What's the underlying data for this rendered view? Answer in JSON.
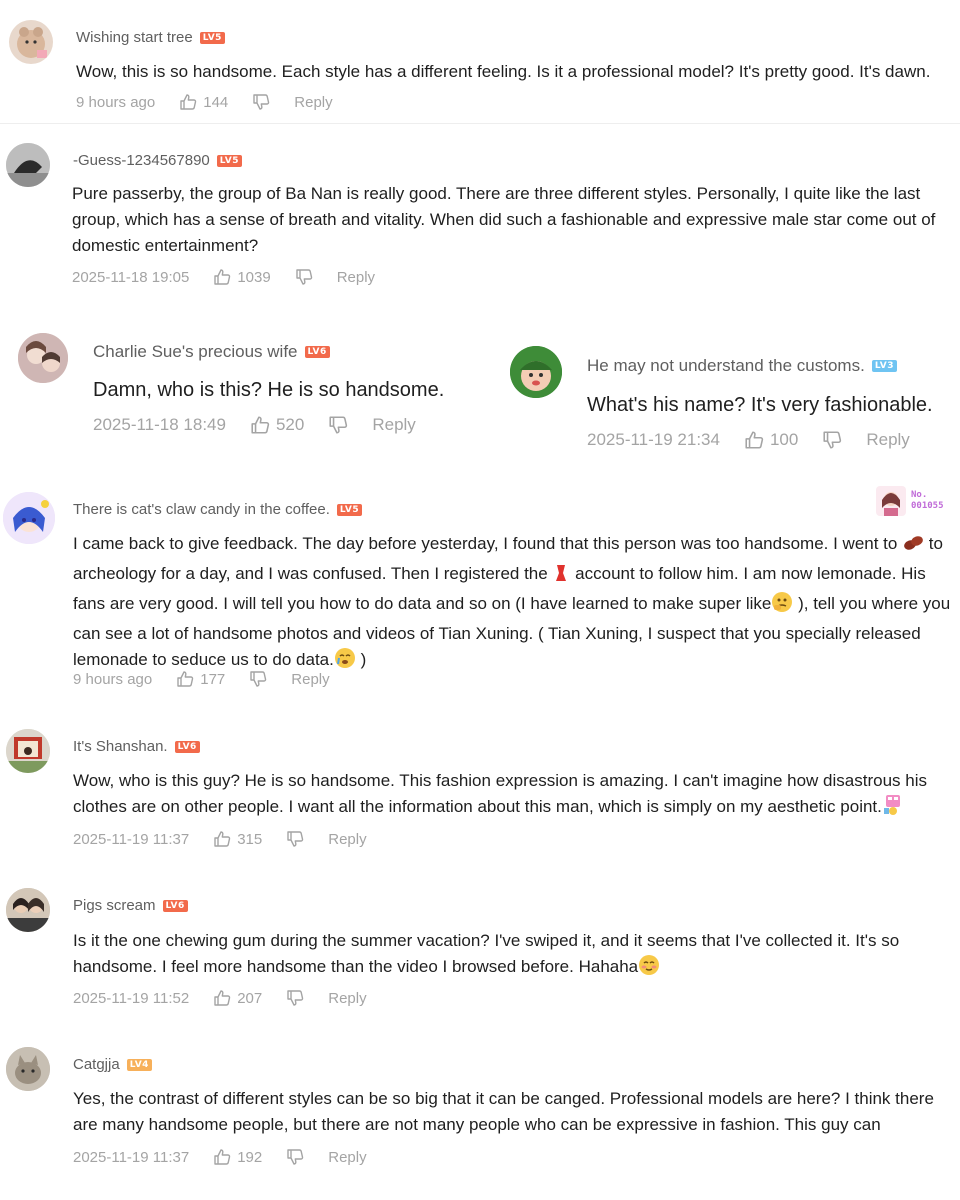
{
  "comments": [
    {
      "user": "Wishing start tree",
      "level": "LV5",
      "text": "Wow, this is so handsome. Each style has a different feeling. Is it a professional model? It's pretty good. It's dawn.",
      "time": "9 hours ago",
      "likes": "144",
      "reply": "Reply"
    },
    {
      "user": "-Guess-1234567890",
      "level": "LV5",
      "text": "Pure passerby, the group of Ba Nan is really good. There are three different styles. Personally, I quite like the last group, which has a sense of breath and vitality. When did such a fashionable and expressive male star come out of domestic entertainment?",
      "time": "2025-11-18 19:05",
      "likes": "1039",
      "reply": "Reply"
    },
    {
      "user": "Charlie Sue's precious wife",
      "level": "LV6",
      "text": "Damn, who is this? He is so handsome.",
      "time": "2025-11-18 18:49",
      "likes": "520",
      "reply": "Reply"
    },
    {
      "user": "He may not understand the customs.",
      "level": "LV3",
      "text": "What's his name? It's very fashionable.",
      "time": "2025-11-19 21:34",
      "likes": "100",
      "reply": "Reply"
    },
    {
      "user": "There is cat's claw candy in the coffee.",
      "level": "LV5",
      "badge_top": "No.",
      "badge_num": "001055",
      "text_parts": [
        "I came back to give feedback. The day before yesterday, I found that this person was too handsome. I went to ",
        " to archeology for a day, and I was confused. Then I registered the ",
        " account to follow him. I am now lemonade. His fans are very good. I will tell you how to do data and so on (I have learned to make super like",
        " ), tell you where you can see a lot of handsome photos and videos of Tian Xuning. ( Tian Xuning, I suspect that you specially released lemonade to seduce us to do data.",
        " )"
      ],
      "time": "9 hours ago",
      "likes": "177",
      "reply": "Reply"
    },
    {
      "user": "It's Shanshan.",
      "level": "LV6",
      "text": "Wow, who is this guy? He is so handsome. This fashion expression is amazing. I can't imagine how disastrous his clothes are on other people. I want all the information about this man, which is simply on my aesthetic point.",
      "time": "2025-11-19 11:37",
      "likes": "315",
      "reply": "Reply"
    },
    {
      "user": "Pigs scream",
      "level": "LV6",
      "text": "Is it the one chewing gum during the summer vacation? I've swiped it, and it seems that I've collected it. It's so handsome. I feel more handsome than the video I browsed before. Hahaha",
      "time": "2025-11-19 11:52",
      "likes": "207",
      "reply": "Reply"
    },
    {
      "user": "Catgjja",
      "level": "LV4",
      "text": "Yes, the contrast of different styles can be so big that it can be canged. Professional models are here? I think there are many handsome people, but there are not many people who can be expressive in fashion. This guy can",
      "time": "2025-11-19 11:37",
      "likes": "192",
      "reply": "Reply"
    }
  ],
  "icons": {
    "like": "thumbs-up-icon",
    "dislike": "thumbs-down-icon",
    "level_badge_color_red": "#f26a4b",
    "level_badge_color_blue": "#6fc4f2",
    "level_badge_color_orange": "#f7b05a"
  }
}
